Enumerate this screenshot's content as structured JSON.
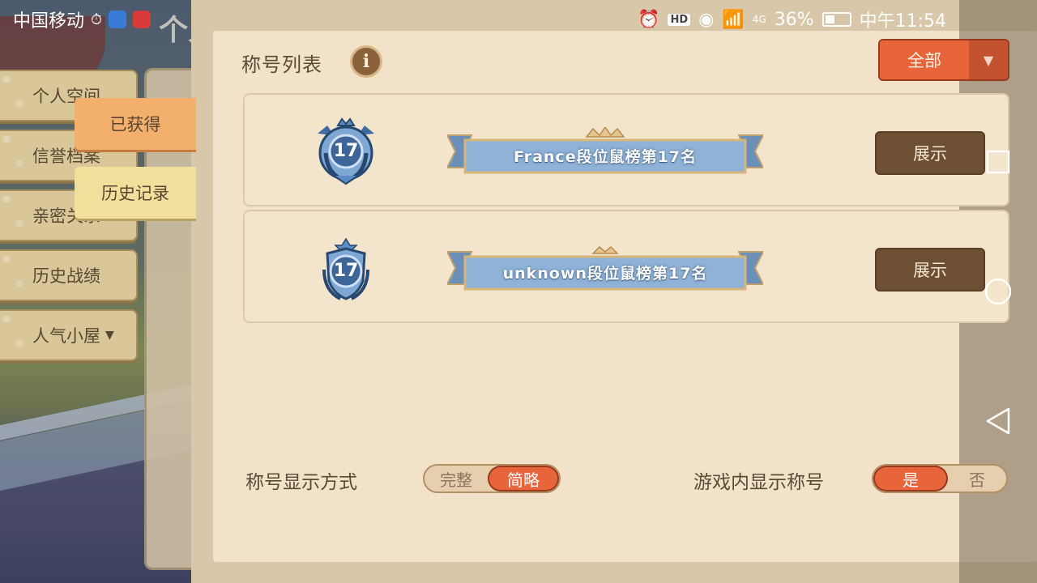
{
  "status_bar": {
    "carrier": "中国移动",
    "battery": "36%",
    "time": "中午11:54",
    "network": "4G",
    "hd": "HD"
  },
  "background": {
    "page_title": "个人"
  },
  "side_menu": {
    "items": [
      {
        "label": "个人空间"
      },
      {
        "label": "信誉档案"
      },
      {
        "label": "亲密关系"
      },
      {
        "label": "历史战绩"
      },
      {
        "label": "人气小屋"
      }
    ],
    "sub_tabs": [
      {
        "label": "已获得",
        "active": true
      },
      {
        "label": "历史记录",
        "active": false
      }
    ]
  },
  "panel": {
    "title": "称号列表",
    "info_icon": "i",
    "filter": {
      "label": "全部",
      "arrow": "▼"
    },
    "titles": [
      {
        "badge_number": "17",
        "name": "France段位鼠榜第17名",
        "button": "展示"
      },
      {
        "badge_number": "17",
        "name": "unknown段位鼠榜第17名",
        "button": "展示"
      }
    ],
    "settings": {
      "display_mode": {
        "label": "称号显示方式",
        "options": [
          "完整",
          "简略"
        ],
        "selected": "简略"
      },
      "ingame_show": {
        "label": "游戏内显示称号",
        "options": [
          "是",
          "否"
        ],
        "selected": "是"
      }
    }
  },
  "colors": {
    "accent": "#e8643a",
    "button_dark": "#6d4f34",
    "panel_bg": "#f2e2c9",
    "banner_blue": "#8fb2d6"
  }
}
